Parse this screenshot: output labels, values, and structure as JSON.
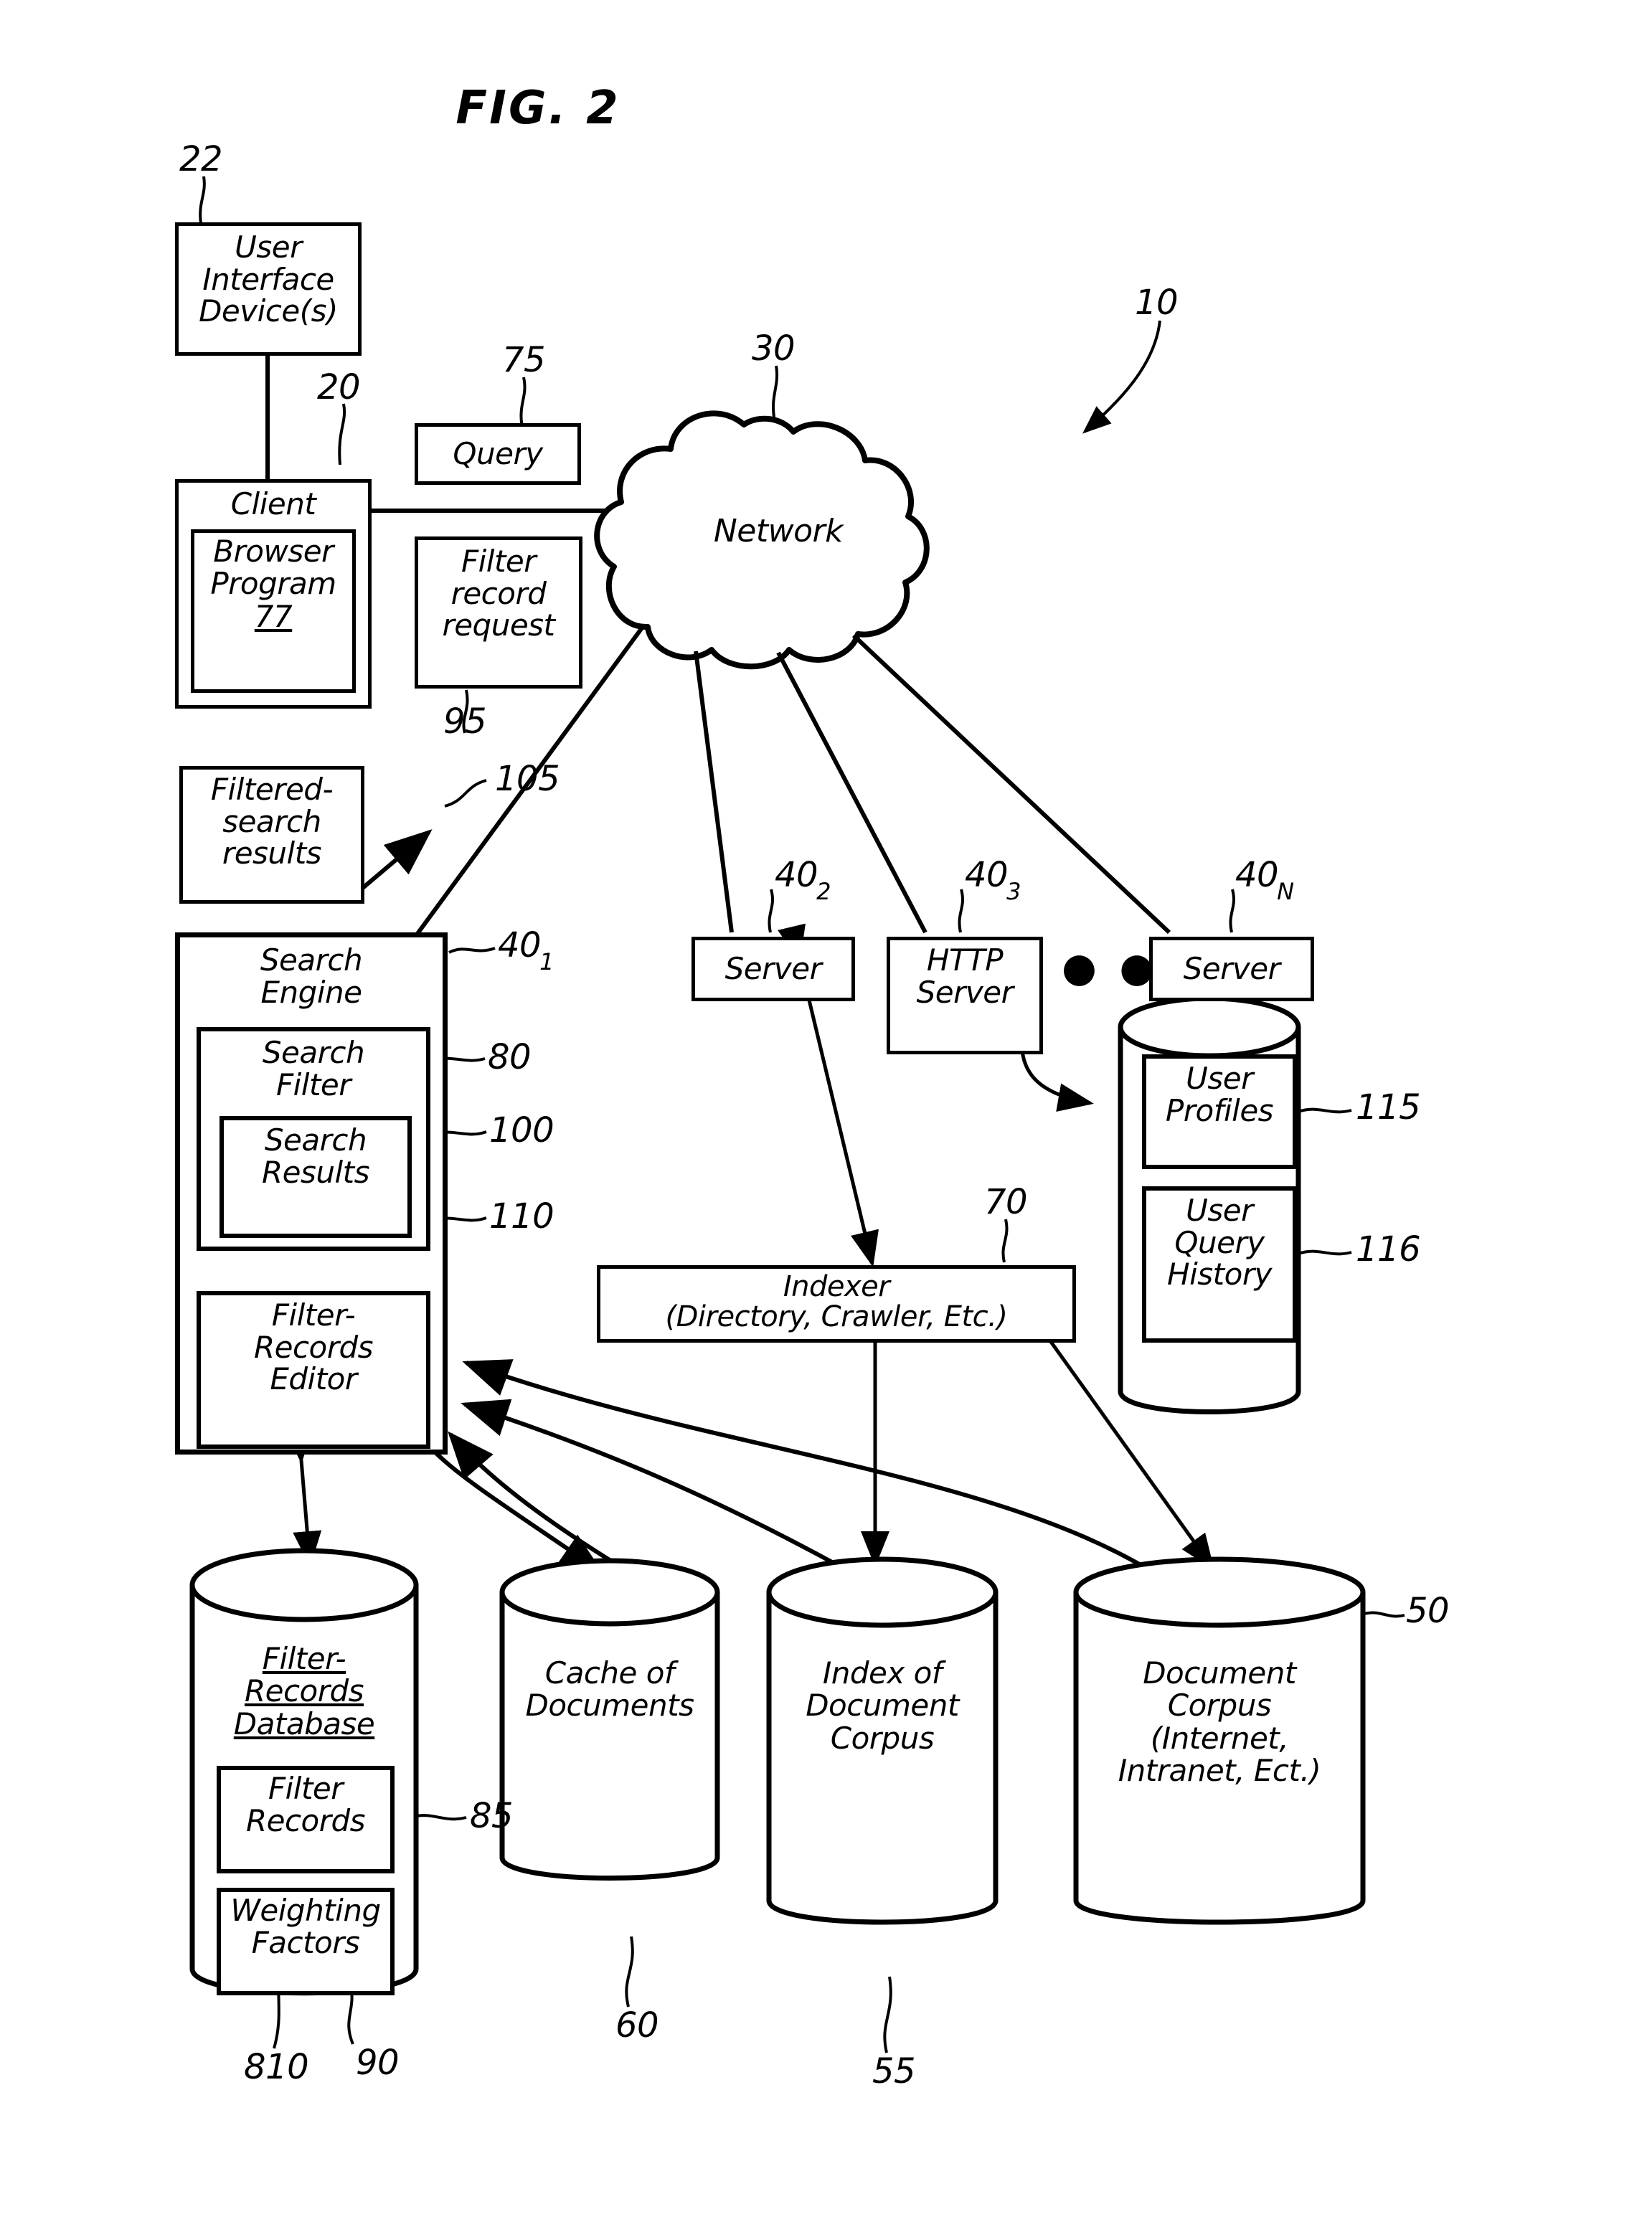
{
  "figure": {
    "title": "FIG. 2",
    "system_ref": "10"
  },
  "nodes": {
    "user_interface_device": {
      "label": "User\nInterface\nDevice(s)",
      "ref": "22"
    },
    "client": {
      "label": "Client",
      "ref": "20"
    },
    "browser_program": {
      "label": "Browser\nProgram",
      "ref": "77"
    },
    "query": {
      "label": "Query",
      "ref": "75"
    },
    "filter_record_request": {
      "label": "Filter\nrecord\nrequest",
      "ref": "95"
    },
    "network": {
      "label": "Network",
      "ref": "30"
    },
    "filtered_search_results": {
      "label": "Filtered-\nsearch\nresults",
      "ref": "105"
    },
    "search_engine": {
      "label": "Search\nEngine",
      "ref": "40",
      "ref_sub": "1"
    },
    "search_filter": {
      "label": "Search\nFilter",
      "ref": "80"
    },
    "search_results": {
      "label": "Search\nResults",
      "ref": "100"
    },
    "filter_records_editor": {
      "label": "Filter-\nRecords\nEditor",
      "ref": "110"
    },
    "server_2": {
      "label": "Server",
      "ref": "40",
      "ref_sub": "2"
    },
    "http_server": {
      "label": "HTTP\nServer",
      "ref": "40",
      "ref_sub": "3"
    },
    "server_n": {
      "label": "Server",
      "ref": "40",
      "ref_sub": "N"
    },
    "server_ellipsis": {
      "label": "● ● ●"
    },
    "user_store": {
      "label": ""
    },
    "user_profiles": {
      "label": "User\nProfiles",
      "ref": "115"
    },
    "user_query_history": {
      "label": "User\nQuery\nHistory",
      "ref": "116"
    },
    "indexer": {
      "label": "Indexer\n(Directory,  Crawler,  Etc.)",
      "ref": "70"
    },
    "filter_records_database": {
      "label": "Filter-\nRecords\nDatabase",
      "ref": "90"
    },
    "filter_records": {
      "label": "Filter\nRecords",
      "ref": "85"
    },
    "weighting_factors": {
      "label": "Weighting\nFactors",
      "ref": "810"
    },
    "cache_of_documents": {
      "label": "Cache of\nDocuments",
      "ref": "60"
    },
    "index_of_document_corpus": {
      "label": "Index of\nDocument\nCorpus",
      "ref": "55"
    },
    "document_corpus": {
      "label": "Document\nCorpus\n(Internet,\nIntranet, Ect.)",
      "ref": "50"
    }
  },
  "colors": {
    "ink": "#000000",
    "paper": "#ffffff"
  }
}
